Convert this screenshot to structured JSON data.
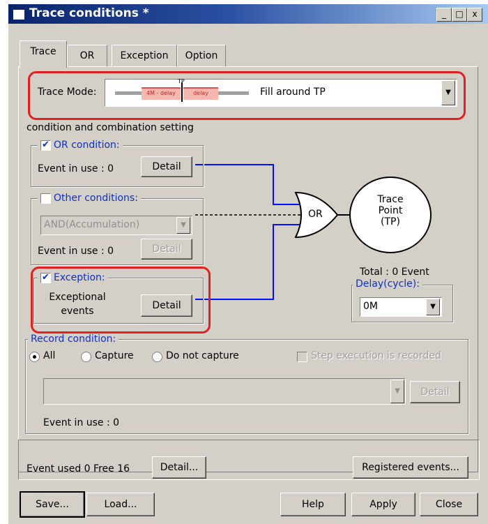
{
  "window": {
    "title": "Trace conditions *",
    "controls": [
      "_",
      "□",
      "x"
    ]
  },
  "tabs": [
    {
      "label": "Trace",
      "active": true
    },
    {
      "label": "OR",
      "active": false
    },
    {
      "label": "Exception",
      "active": false
    },
    {
      "label": "Option",
      "active": false
    }
  ],
  "trace_mode": {
    "label": "Trace Mode:",
    "selected": "Fill around TP",
    "preview": {
      "tp": "TP",
      "left": "4M - delay",
      "right": "delay"
    }
  },
  "combination": {
    "heading": "condition and combination setting",
    "or_condition": {
      "label": "OR condition:",
      "checked": true,
      "event_text": "Event in use :  0",
      "detail": "Detail"
    },
    "other_conditions": {
      "label": "Other conditions:",
      "checked": false,
      "select_value": "AND(Accumulation)",
      "event_text": "Event in use : 0",
      "detail": "Detail"
    },
    "exception": {
      "label": "Exception:",
      "checked": true,
      "text1": "Exceptional",
      "text2": "events",
      "detail": "Detail"
    },
    "gate_label": "OR",
    "trace_point": {
      "line1": "Trace",
      "line2": "Point",
      "line3": "(TP)"
    },
    "total": "Total :  0  Event",
    "delay": {
      "label": "Delay(cycle):",
      "value": "0M"
    }
  },
  "record": {
    "label": "Record condition:",
    "options": [
      {
        "label": "All",
        "selected": true
      },
      {
        "label": "Capture",
        "selected": false
      },
      {
        "label": "Do not capture",
        "selected": false
      }
    ],
    "step_label": "Step execution is recorded",
    "detail": "Detail",
    "event_text": "Event in use : 0"
  },
  "footer": {
    "event_used": "Event used   0  Free 16",
    "detail": "Detail...",
    "registered": "Registered events...",
    "save": "Save...",
    "load": "Load...",
    "help": "Help",
    "apply": "Apply",
    "close": "Close"
  },
  "colors": {
    "accent_blue": "#1030c0",
    "highlight_red": "#e02020",
    "line_blue": "#0010ff"
  }
}
